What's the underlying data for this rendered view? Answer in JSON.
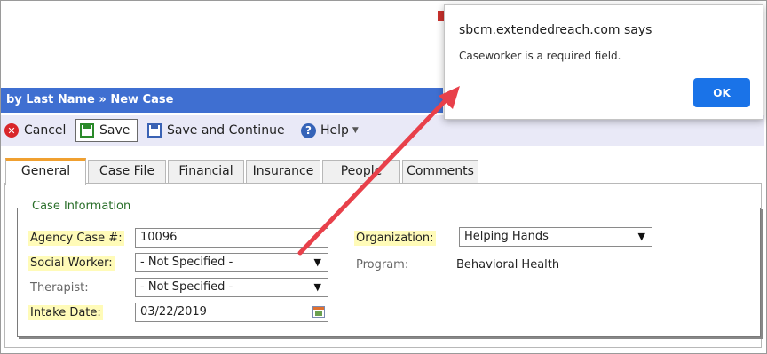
{
  "breadcrumb": {
    "part1": "by Last Name",
    "sep": " » ",
    "part2": "New Case"
  },
  "toolbar": {
    "cancel_label": "Cancel",
    "save_label": "Save",
    "save_continue_label": "Save and Continue",
    "help_label": "Help"
  },
  "tabs": [
    {
      "label": "General",
      "active": true
    },
    {
      "label": "Case File"
    },
    {
      "label": "Financial"
    },
    {
      "label": "Insurance"
    },
    {
      "label": "People"
    },
    {
      "label": "Comments"
    }
  ],
  "case_info": {
    "legend": "Case Information",
    "agency_case_label": "Agency Case #:",
    "agency_case_value": "10096",
    "social_worker_label": "Social Worker:",
    "social_worker_value": "- Not Specified -",
    "therapist_label": "Therapist:",
    "therapist_value": "- Not Specified -",
    "intake_date_label": "Intake Date:",
    "intake_date_value": "03/22/2019",
    "organization_label": "Organization:",
    "organization_value": "Helping Hands",
    "program_label": "Program:",
    "program_value": "Behavioral Health"
  },
  "dialog": {
    "title": "sbcm.extendedreach.com says",
    "message": "Caseworker is a required field.",
    "ok_label": "OK"
  },
  "colors": {
    "accent": "#3f6fd1",
    "required_highlight": "#fffbb8",
    "arrow": "#e8404a",
    "ok_button": "#1a73e8"
  }
}
